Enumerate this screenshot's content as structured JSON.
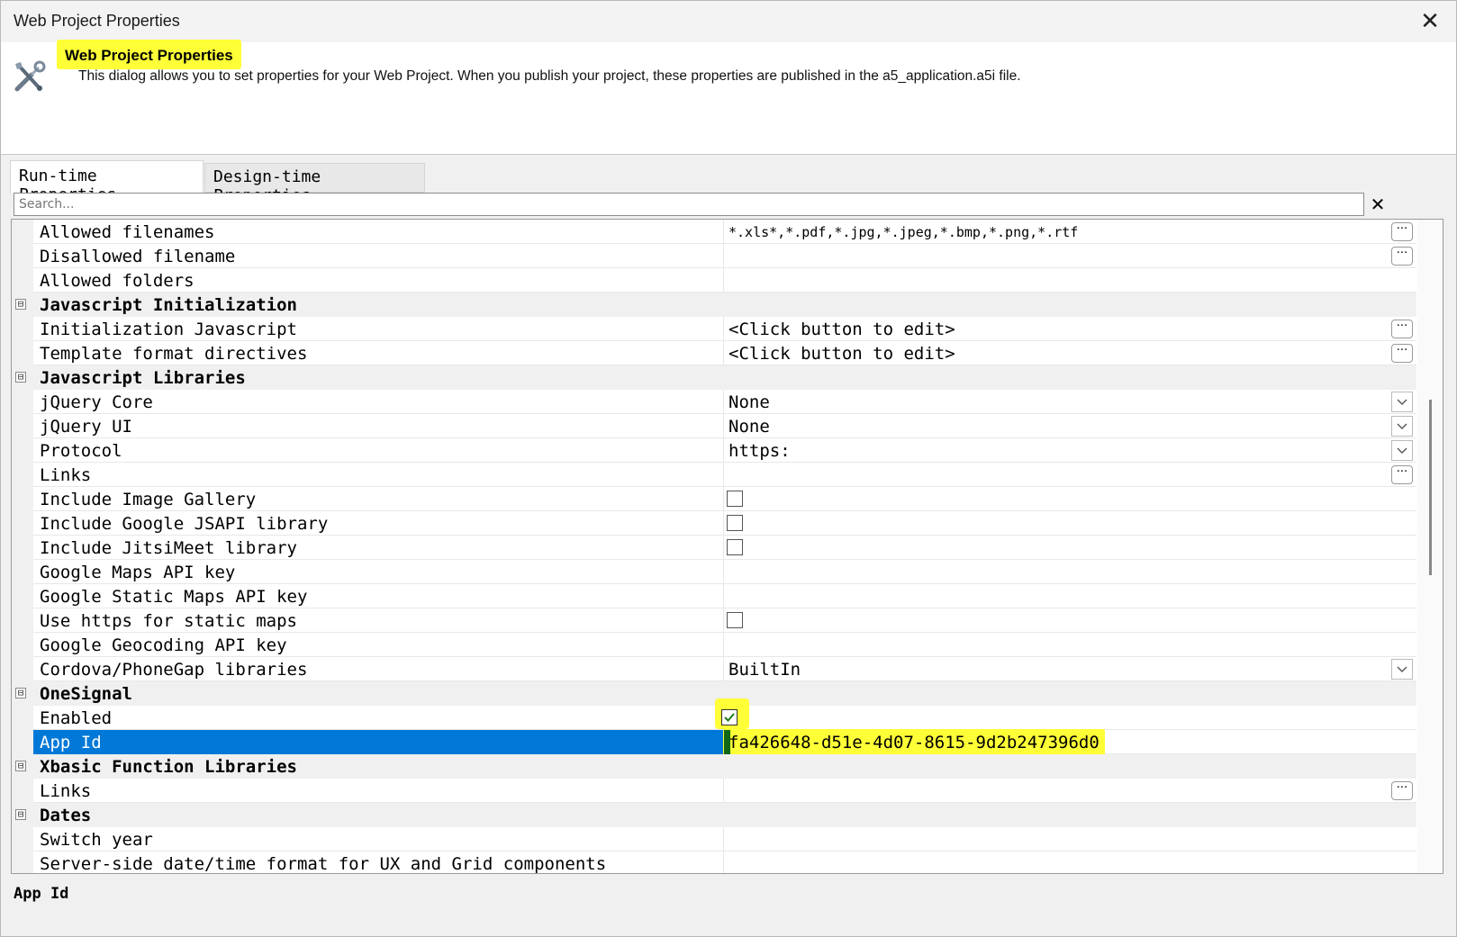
{
  "window": {
    "title": "Web Project Properties",
    "close_glyph": "✕"
  },
  "header": {
    "icon": "tools-icon",
    "title": "Web Project Properties",
    "description": "This dialog allows you to set properties for your Web Project. When you publish your project, these properties are published in the a5_application.a5i file."
  },
  "tabs": [
    {
      "label": "Run-time Properties",
      "active": true
    },
    {
      "label": "Design-time Properties",
      "active": false
    }
  ],
  "search": {
    "placeholder": "Search...",
    "value": "",
    "clear_glyph": "✕"
  },
  "rows": [
    {
      "type": "property",
      "name": "Allowed filenames",
      "value": "*.xls*,*.pdf,*.jpg,*.jpeg,*.bmp,*.png,*.rtf",
      "editor": "ellipsis",
      "small": true
    },
    {
      "type": "property",
      "name": "Disallowed filename",
      "value": "",
      "editor": "ellipsis"
    },
    {
      "type": "property",
      "name": "Allowed folders",
      "value": "",
      "editor": ""
    },
    {
      "type": "category",
      "name": "Javascript Initialization"
    },
    {
      "type": "property",
      "name": "Initialization Javascript",
      "value": "<Click button to edit>",
      "editor": "ellipsis"
    },
    {
      "type": "property",
      "name": "Template format directives",
      "value": "<Click button to edit>",
      "editor": "ellipsis"
    },
    {
      "type": "category",
      "name": "Javascript Libraries"
    },
    {
      "type": "property",
      "name": "jQuery Core",
      "value": "None",
      "editor": "dropdown"
    },
    {
      "type": "property",
      "name": "jQuery UI",
      "value": "None",
      "editor": "dropdown"
    },
    {
      "type": "property",
      "name": "Protocol",
      "value": "https:",
      "editor": "dropdown"
    },
    {
      "type": "property",
      "name": "Links",
      "value": "",
      "editor": "ellipsis"
    },
    {
      "type": "property",
      "name": "Include Image Gallery",
      "value": "",
      "editor": "checkbox",
      "checked": false
    },
    {
      "type": "property",
      "name": "Include Google JSAPI library",
      "value": "",
      "editor": "checkbox",
      "checked": false
    },
    {
      "type": "property",
      "name": "Include JitsiMeet library",
      "value": "",
      "editor": "checkbox",
      "checked": false
    },
    {
      "type": "property",
      "name": "Google Maps API key",
      "value": "",
      "editor": ""
    },
    {
      "type": "property",
      "name": "Google Static Maps API key",
      "value": "",
      "editor": ""
    },
    {
      "type": "property",
      "name": "Use https for static maps",
      "value": "",
      "editor": "checkbox",
      "checked": false
    },
    {
      "type": "property",
      "name": "Google Geocoding API key",
      "value": "",
      "editor": ""
    },
    {
      "type": "property",
      "name": "Cordova/PhoneGap libraries",
      "value": "BuiltIn",
      "editor": "dropdown"
    },
    {
      "type": "category",
      "name": "OneSignal"
    },
    {
      "type": "property",
      "name": "Enabled",
      "value": "",
      "editor": "checkbox",
      "checked": true,
      "highlight": true
    },
    {
      "type": "property",
      "name": "App Id",
      "value": "fa426648-d51e-4d07-8615-9d2b247396d0",
      "editor": "",
      "selected": true
    },
    {
      "type": "category",
      "name": "Xbasic Function Libraries"
    },
    {
      "type": "property",
      "name": "Links",
      "value": "",
      "editor": "ellipsis"
    },
    {
      "type": "category",
      "name": "Dates"
    },
    {
      "type": "property",
      "name": "Switch year",
      "value": "",
      "editor": ""
    },
    {
      "type": "property",
      "name": "Server-side date/time format for UX and Grid components",
      "value": "",
      "editor": ""
    }
  ],
  "category_toggle_glyph": "⊟",
  "ellipsis_glyph": "···",
  "checkmark_glyph": "✓",
  "status": {
    "selected_property": "App Id"
  },
  "colors": {
    "highlight": "#ffff38",
    "selection": "#0078d7",
    "selected_marker": "#116611"
  }
}
